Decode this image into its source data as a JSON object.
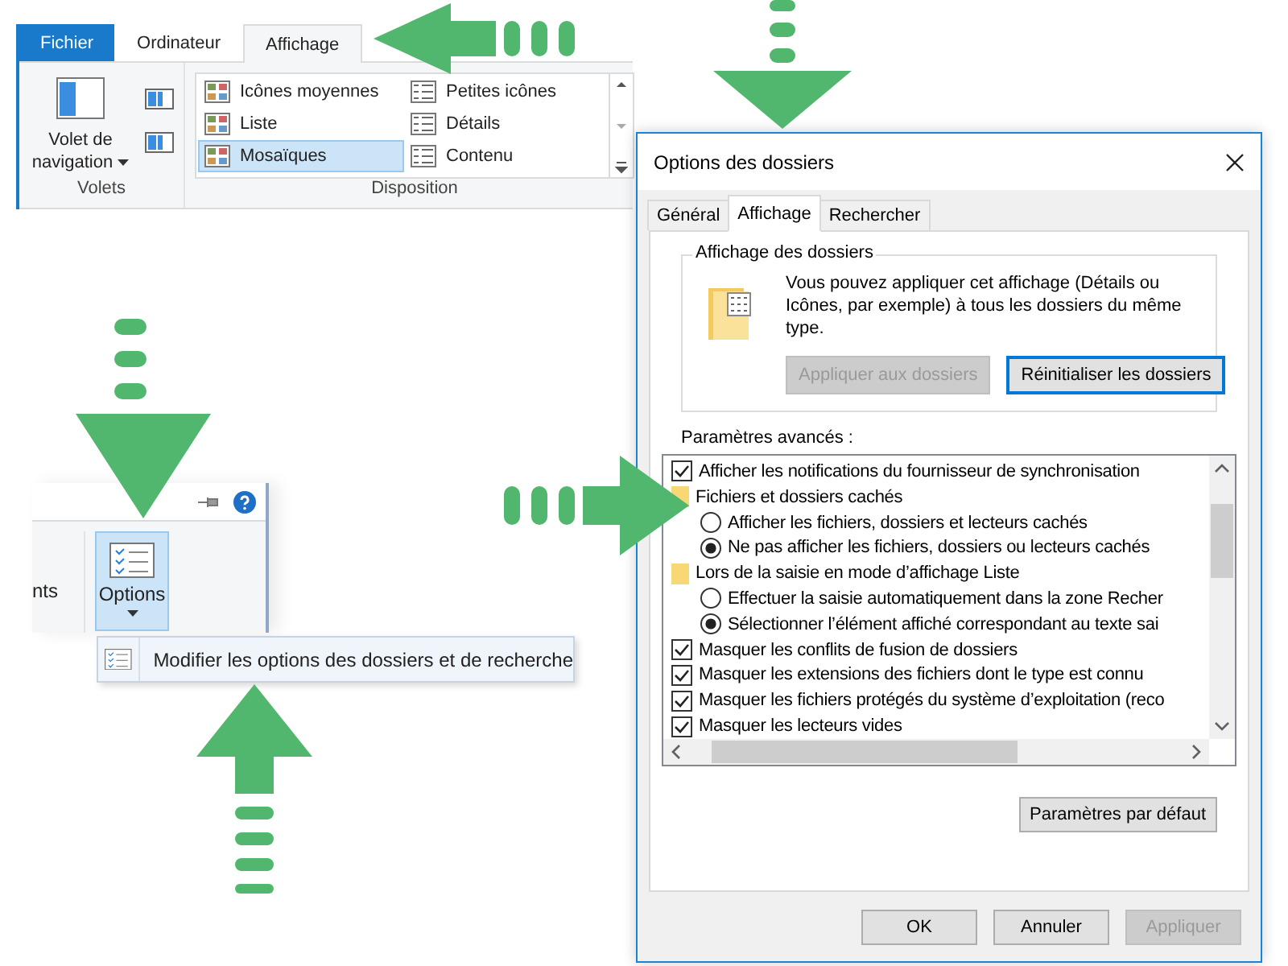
{
  "ribbon": {
    "tabs": [
      {
        "label": "Fichier",
        "kind": "file",
        "selected": false
      },
      {
        "label": "Ordinateur",
        "kind": "tab",
        "selected": false
      },
      {
        "label": "Affichage",
        "kind": "tab",
        "selected": true
      }
    ],
    "panes": {
      "button": "Volet de navigation",
      "label": "Volets"
    },
    "layout": {
      "label": "Disposition",
      "items": [
        {
          "label": "Icônes moyennes",
          "selected": false
        },
        {
          "label": "Petites icônes",
          "selected": false
        },
        {
          "label": "Liste",
          "selected": false
        },
        {
          "label": "Détails",
          "selected": false
        },
        {
          "label": "Mosaïques",
          "selected": true
        },
        {
          "label": "Contenu",
          "selected": false
        }
      ]
    }
  },
  "options_panel": {
    "cut_label": "nts",
    "button": {
      "label": "Options",
      "selected": true
    },
    "menu_item": "Modifier les options des dossiers et de recherche"
  },
  "dialog": {
    "title": "Options des dossiers",
    "tabs": [
      {
        "label": "Général",
        "selected": false
      },
      {
        "label": "Affichage",
        "selected": true
      },
      {
        "label": "Rechercher",
        "selected": false
      }
    ],
    "folder_views": {
      "title": "Affichage des dossiers",
      "text": "Vous pouvez appliquer cet affichage (Détails ou Icônes, par exemple) à tous les dossiers du même type.",
      "buttons": [
        {
          "label": "Appliquer aux dossiers",
          "disabled": true
        },
        {
          "label": "Réinitialiser les dossiers",
          "disabled": false
        }
      ]
    },
    "advanced": {
      "label": "Paramètres avancés :",
      "items": [
        {
          "kind": "checkbox",
          "label": "Afficher les notifications du fournisseur de synchronisation",
          "checked": true
        },
        {
          "kind": "group",
          "label": "Fichiers et dossiers cachés",
          "children": [
            {
              "kind": "radio",
              "label": "Afficher les fichiers, dossiers et lecteurs cachés",
              "selected": false
            },
            {
              "kind": "radio",
              "label": "Ne pas afficher les fichiers, dossiers ou lecteurs cachés",
              "selected": true
            }
          ]
        },
        {
          "kind": "group",
          "label": "Lors de la saisie en mode d’affichage Liste",
          "children": [
            {
              "kind": "radio",
              "label": "Effectuer la saisie automatiquement dans la zone Recher",
              "selected": false
            },
            {
              "kind": "radio",
              "label": "Sélectionner l’élément affiché correspondant au texte sai",
              "selected": true
            }
          ]
        },
        {
          "kind": "checkbox",
          "label": "Masquer les conflits de fusion de dossiers",
          "checked": true
        },
        {
          "kind": "checkbox",
          "label": "Masquer les extensions des fichiers dont le type est connu",
          "checked": true
        },
        {
          "kind": "checkbox",
          "label": "Masquer les fichiers protégés du système d’exploitation (reco",
          "checked": true
        },
        {
          "kind": "checkbox",
          "label": "Masquer les lecteurs vides",
          "checked": true
        }
      ]
    },
    "defaults_button": "Paramètres par défaut",
    "buttons": [
      {
        "label": "OK",
        "disabled": false
      },
      {
        "label": "Annuler",
        "disabled": false
      },
      {
        "label": "Appliquer",
        "disabled": true
      }
    ]
  }
}
